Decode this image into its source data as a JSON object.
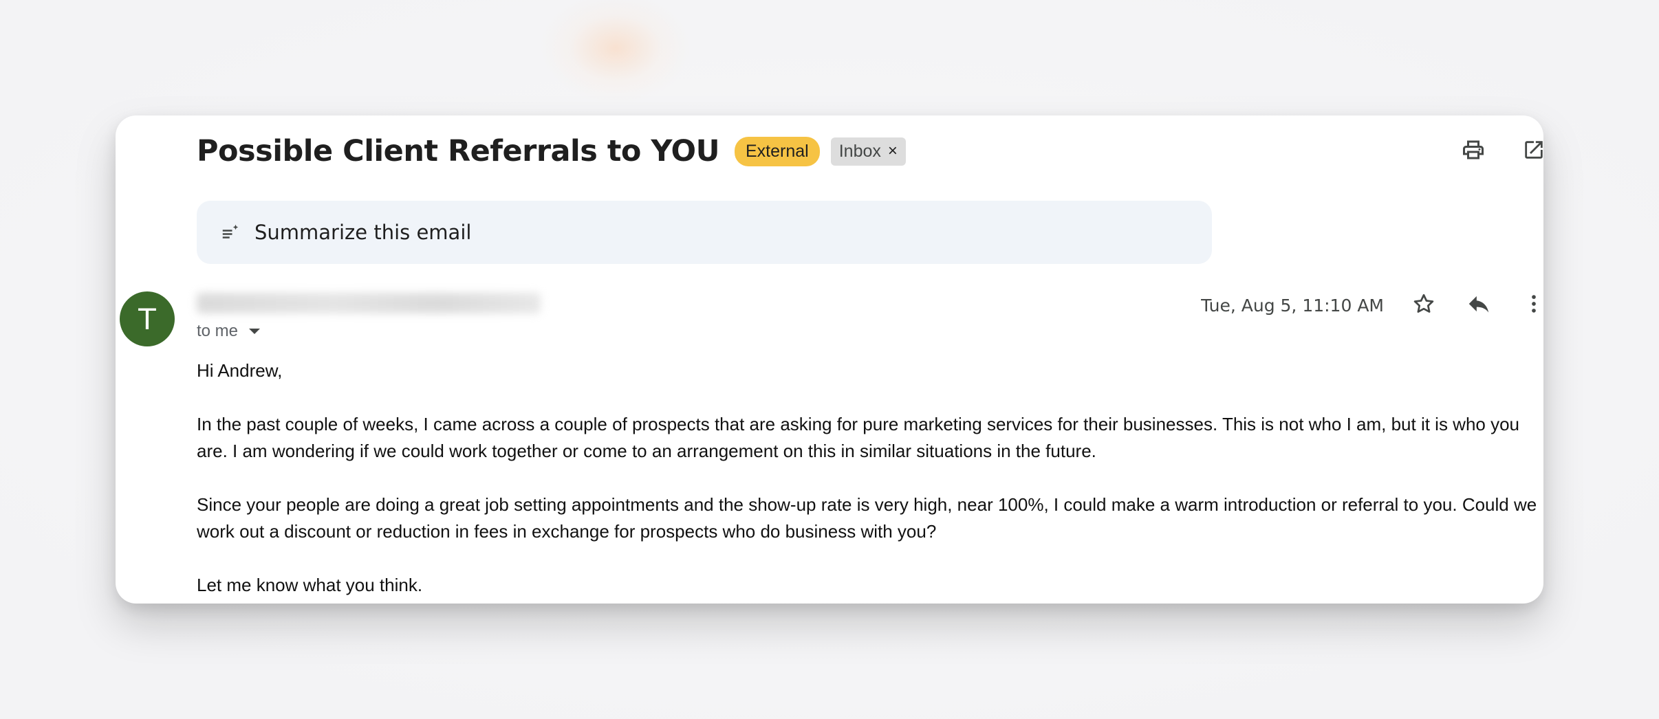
{
  "email": {
    "subject": "Possible Client Referrals to YOU",
    "labels": {
      "external": "External",
      "inbox": "Inbox",
      "inbox_remove": "×"
    },
    "summarize_label": "Summarize this email",
    "sender": {
      "avatar_letter": "T",
      "avatar_color": "#3b6a2a"
    },
    "recipient_label": "to me",
    "date": "Tue, Aug 5, 11:10 AM",
    "body": {
      "greeting": "Hi Andrew,",
      "paragraph1": "In the past couple of weeks, I came across a couple of prospects that are asking for pure marketing services for their businesses. This is not who I am, but it is who you are. I am wondering if we could work together or come to an arrangement on this in similar situations in the future.",
      "paragraph2": "Since your people are doing a great job setting appointments and the show-up rate is very high, near 100%, I could make a warm introduction or referral to you. Could we work out a discount or reduction in fees in exchange for prospects who do business with you?",
      "closing": "Let me know what you think."
    }
  },
  "icons": [
    "print-icon",
    "open-in-new-window-icon",
    "summarize-icon",
    "caret-down-icon",
    "star-icon",
    "reply-icon",
    "more-vert-icon"
  ],
  "colors": {
    "external_badge": "#f6c344",
    "inbox_badge": "#dddddd",
    "summarize_bg": "#f0f4f9"
  }
}
